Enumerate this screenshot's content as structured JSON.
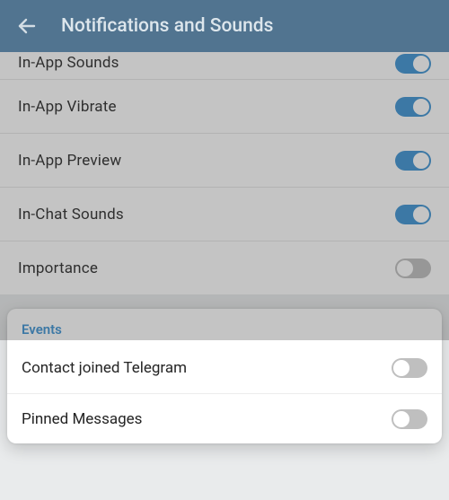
{
  "header": {
    "title": "Notifications and Sounds"
  },
  "settings": {
    "rows": [
      {
        "label": "In-App Sounds",
        "on": true
      },
      {
        "label": "In-App Vibrate",
        "on": true
      },
      {
        "label": "In-App Preview",
        "on": true
      },
      {
        "label": "In-Chat Sounds",
        "on": true
      },
      {
        "label": "Importance",
        "on": false
      }
    ]
  },
  "events": {
    "header": "Events",
    "rows": [
      {
        "label": "Contact joined Telegram",
        "on": false
      },
      {
        "label": "Pinned Messages",
        "on": false
      }
    ]
  },
  "colors": {
    "headerBg": "#517490",
    "accent": "#3d93d3",
    "toggleOff": "#bfbfbf"
  }
}
